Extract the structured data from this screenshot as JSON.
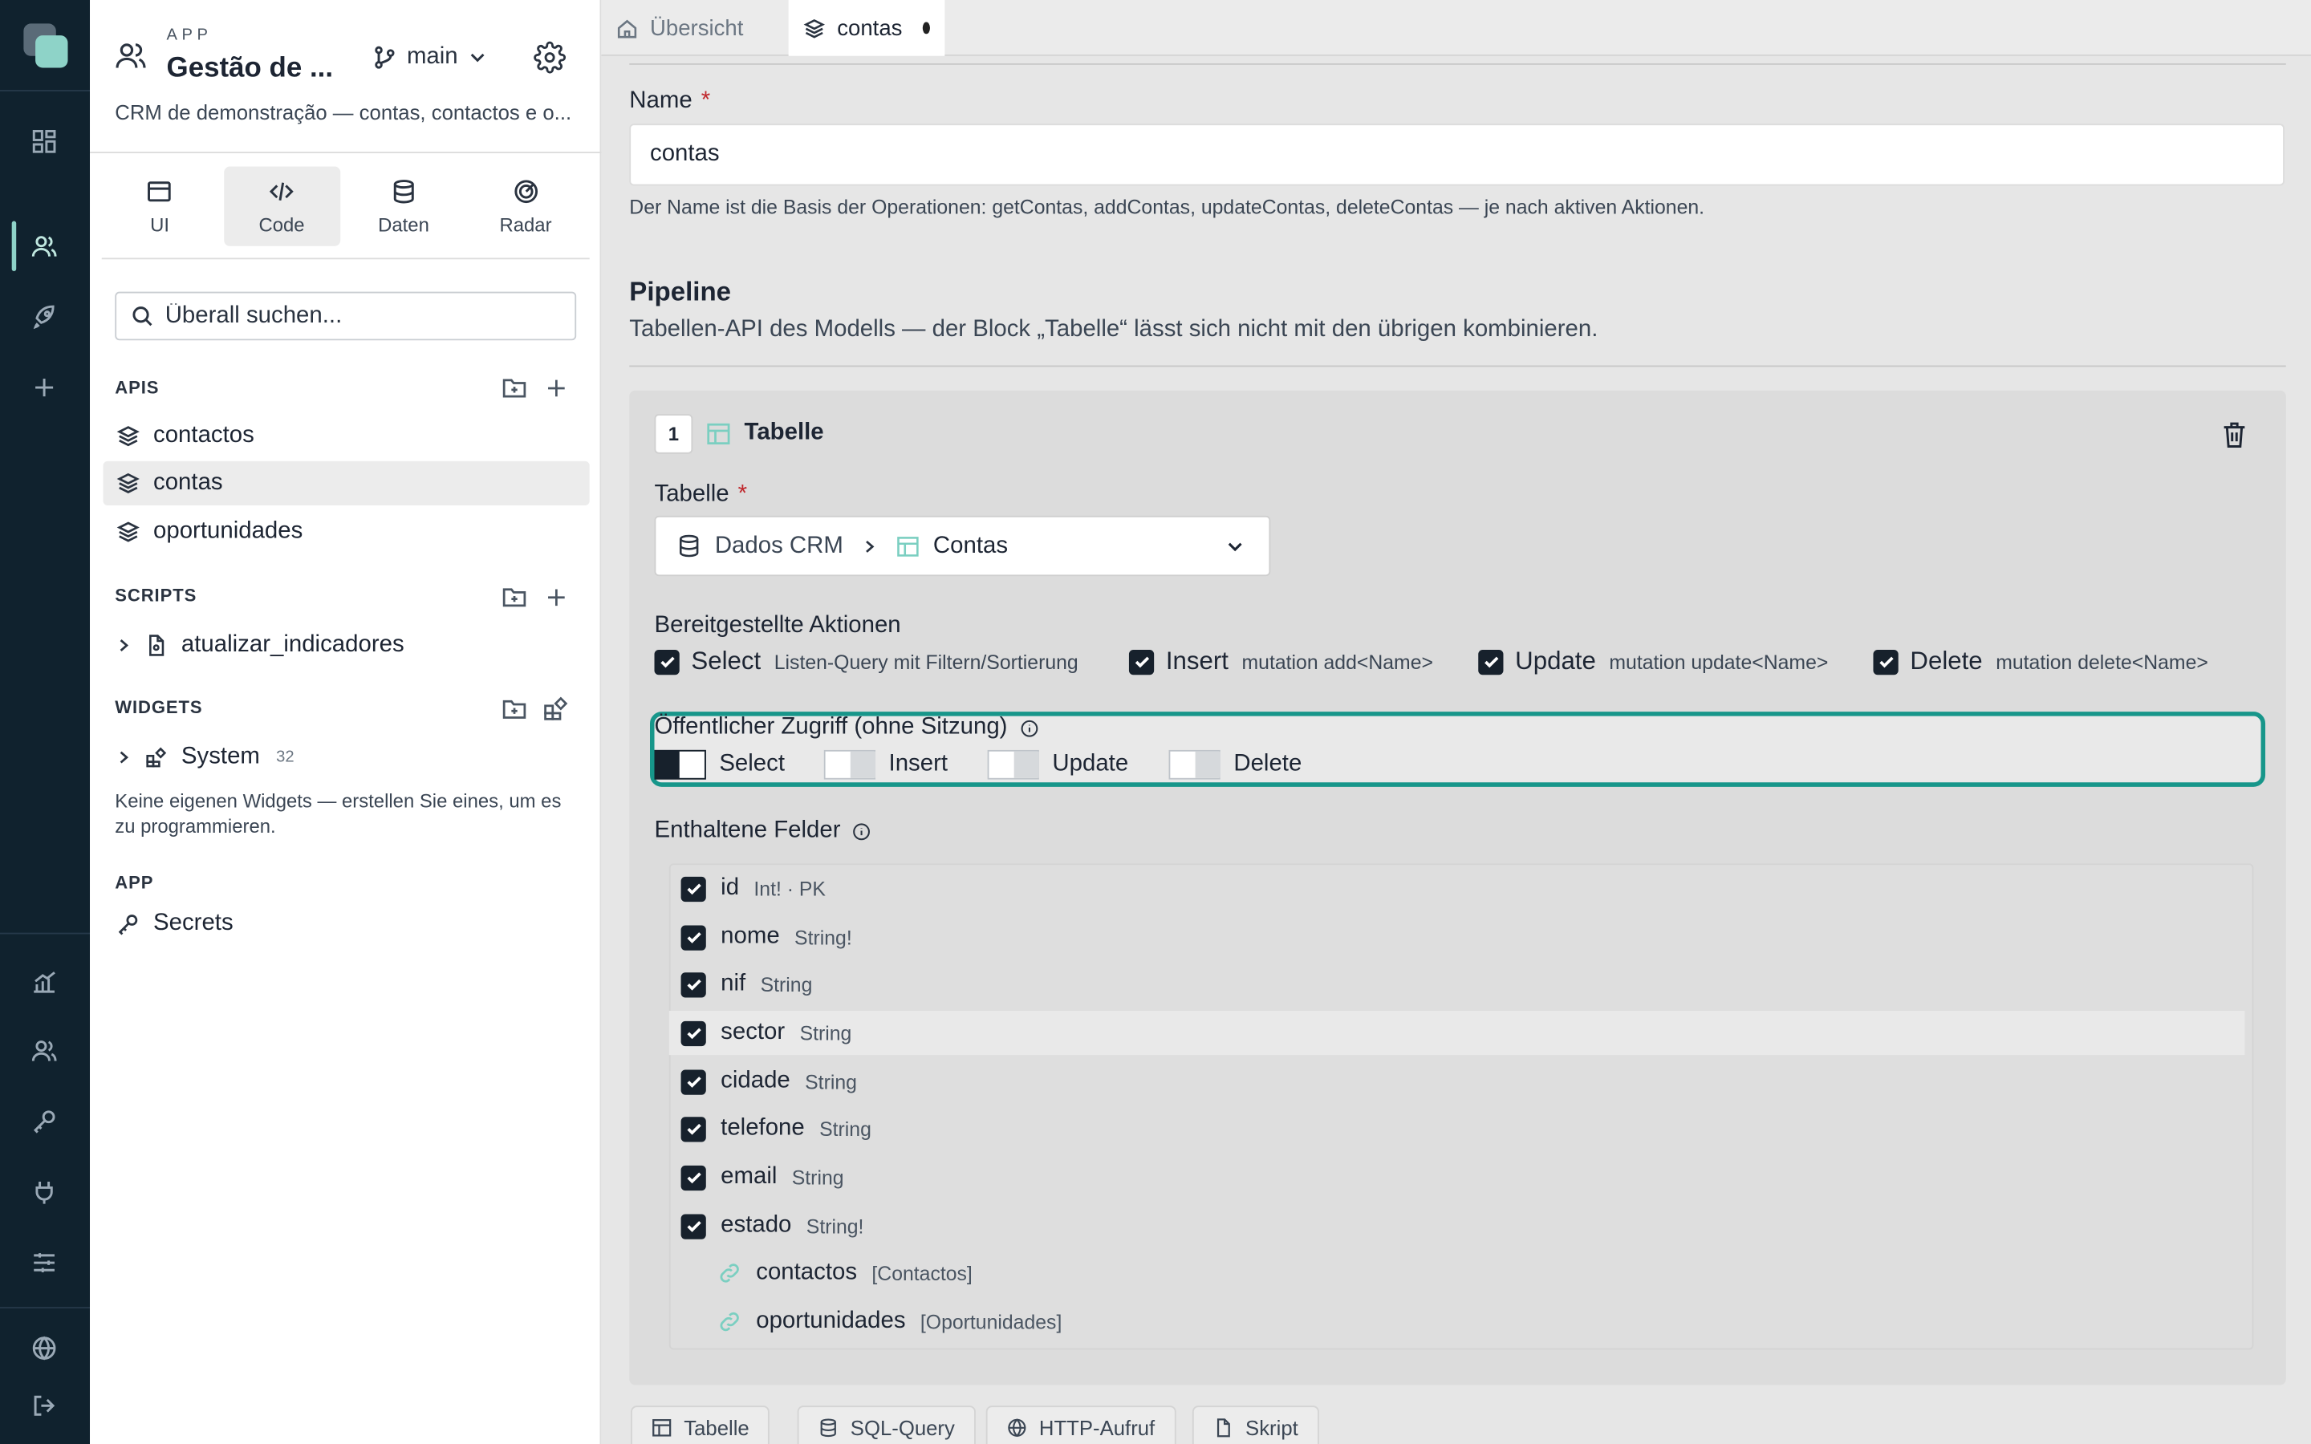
{
  "app": {
    "kicker": "APP",
    "title": "Gestão de ...",
    "branch": "main",
    "description": "CRM de demonstração — contas, contactos e o..."
  },
  "modes": [
    {
      "label": "UI",
      "icon": "window-icon"
    },
    {
      "label": "Code",
      "icon": "code-icon",
      "active": true
    },
    {
      "label": "Daten",
      "icon": "database-icon"
    },
    {
      "label": "Radar",
      "icon": "radar-icon"
    }
  ],
  "search": {
    "placeholder": "Überall suchen..."
  },
  "sections": {
    "apis": {
      "title": "APIS",
      "items": [
        "contactos",
        "contas",
        "oportunidades"
      ],
      "selected": "contas"
    },
    "scripts": {
      "title": "SCRIPTS",
      "items": [
        "atualizar_indicadores"
      ]
    },
    "widgets": {
      "title": "WIDGETS",
      "items": [
        {
          "label": "System",
          "count": "32"
        }
      ],
      "note": "Keine eigenen Widgets — erstellen Sie eines, um es zu programmieren."
    },
    "app": {
      "title": "APP",
      "items": [
        "Secrets"
      ]
    }
  },
  "tabs": [
    {
      "label": "Übersicht",
      "icon": "home-icon"
    },
    {
      "label": "contas",
      "icon": "layers-icon",
      "active": true,
      "unsaved": true
    }
  ],
  "form": {
    "name_label": "Name",
    "name_value": "contas",
    "name_hint": "Der Name ist die Basis der Operationen: getContas, addContas, updateContas, deleteContas — je nach aktiven Aktionen.",
    "pipeline_title": "Pipeline",
    "pipeline_subtitle": "Tabellen-API des Modells — der Block „Tabelle“ lässt sich nicht mit den übrigen kombinieren."
  },
  "block": {
    "number": "1",
    "title": "Tabelle",
    "table_label": "Tabelle",
    "table_source": "Dados CRM",
    "table_name": "Contas",
    "actions_label": "Bereitgestellte Aktionen",
    "actions": [
      {
        "name": "Select",
        "desc": "Listen-Query mit Filtern/Sortierung",
        "checked": true
      },
      {
        "name": "Insert",
        "desc": "mutation add<Name>",
        "checked": true
      },
      {
        "name": "Update",
        "desc": "mutation update<Name>",
        "checked": true
      },
      {
        "name": "Delete",
        "desc": "mutation delete<Name>",
        "checked": true
      }
    ],
    "public_access_label": "Öffentlicher Zugriff (ohne Sitzung)",
    "public_access": [
      {
        "name": "Select",
        "on": true
      },
      {
        "name": "Insert",
        "on": false
      },
      {
        "name": "Update",
        "on": false
      },
      {
        "name": "Delete",
        "on": false
      }
    ],
    "fields_label": "Enthaltene Felder",
    "fields": [
      {
        "name": "id",
        "type": "Int! · PK",
        "checked": true
      },
      {
        "name": "nome",
        "type": "String!",
        "checked": true
      },
      {
        "name": "nif",
        "type": "String",
        "checked": true
      },
      {
        "name": "sector",
        "type": "String",
        "checked": true
      },
      {
        "name": "cidade",
        "type": "String",
        "checked": true
      },
      {
        "name": "telefone",
        "type": "String",
        "checked": true
      },
      {
        "name": "email",
        "type": "String",
        "checked": true
      },
      {
        "name": "estado",
        "type": "String!",
        "checked": true
      },
      {
        "name": "contactos",
        "type": "[Contactos]",
        "relation": true
      },
      {
        "name": "oportunidades",
        "type": "[Oportunidades]",
        "relation": true
      }
    ]
  },
  "add_blocks": [
    {
      "label": "Tabelle",
      "icon": "table-icon"
    },
    {
      "label": "SQL-Query",
      "icon": "database-icon"
    },
    {
      "label": "HTTP-Aufruf",
      "icon": "globe-icon"
    },
    {
      "label": "Skript",
      "icon": "script-icon"
    }
  ],
  "colors": {
    "rail": "#10222e",
    "accent": "#8ed3c8",
    "focus_ring": "#17968a",
    "required": "#c0282d",
    "checkbox": "#17212c"
  }
}
